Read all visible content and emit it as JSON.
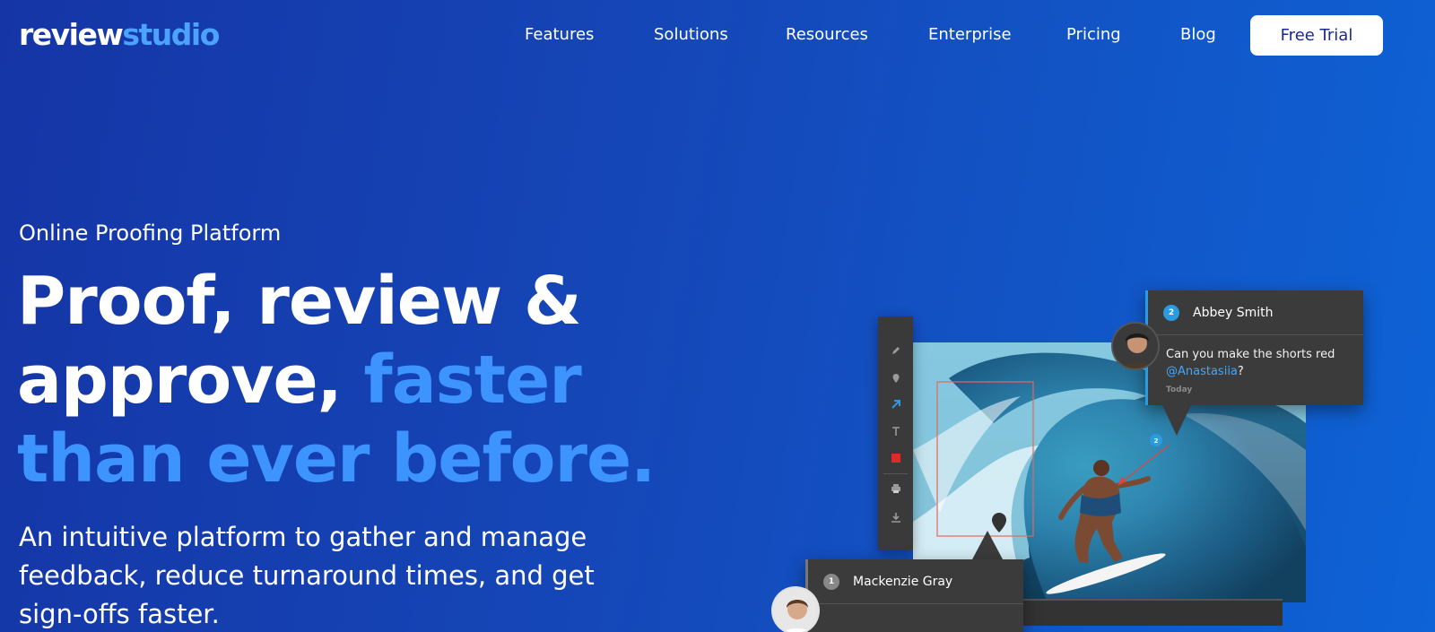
{
  "brand": {
    "part1": "review",
    "part2": "studio"
  },
  "nav": {
    "links": [
      "Features",
      "Solutions",
      "Resources",
      "Enterprise",
      "Pricing",
      "Blog"
    ],
    "cta": "Free Trial"
  },
  "hero": {
    "eyebrow": "Online Proofing Platform",
    "headline_line1": "Proof, review &",
    "headline_line2_a": "approve, ",
    "headline_line2_b": "faster",
    "headline_line3": "than ever before.",
    "subtext": "An intuitive platform to gather and manage feedback, reduce turnaround times, and get sign-offs faster."
  },
  "mockup": {
    "comment1": {
      "number": "2",
      "author": "Abbey Smith",
      "text": "Can you make the shorts red ",
      "mention": "@Anastasiia",
      "punct": "?",
      "time": "Today"
    },
    "comment2": {
      "number": "1",
      "author": "Mackenzie Gray"
    },
    "marker_number": "2",
    "icons": [
      "pencil-icon",
      "pin-icon",
      "arrow-icon",
      "text-icon",
      "color-swatch-icon",
      "print-icon",
      "download-icon"
    ]
  },
  "colors": {
    "accent": "#3d94ff",
    "logo_accent": "#4ba3ff",
    "mention": "#3fa8ff",
    "button_text": "#1a2a8c"
  }
}
